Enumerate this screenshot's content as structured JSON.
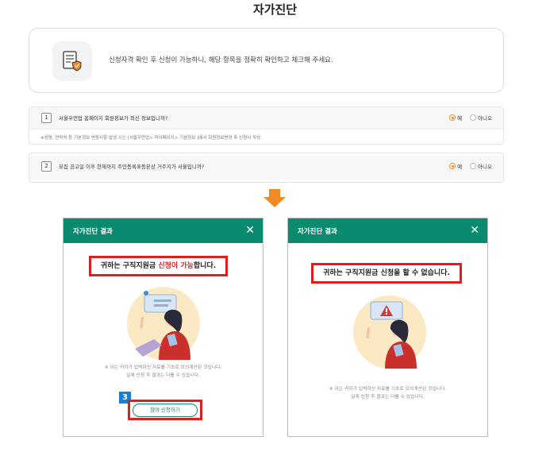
{
  "page": {
    "title": "자가진단"
  },
  "notice": {
    "text": "신청자격 확인 후 신청이 가능하니, 해당 항목을 정확히 확인하고 체크해 주세요."
  },
  "questions": [
    {
      "number": "1",
      "text": "서울우먼업 홈페이지 회원정보가 최신 정보입니까?",
      "note": "※성명, 연락처 등 기본정보 변동사항 발생 시는 [서울우먼업> 마이페이지> 기본정보 ]에서 회원정보변경 후 신청서 작성.",
      "options": [
        "예",
        "아니오"
      ],
      "selected": "예"
    },
    {
      "number": "2",
      "text": "모집 공고일 이후 현재까지 주민등록표등본상 거주지가 서울입니까?",
      "options": [
        "예",
        "아니오"
      ],
      "selected": "예"
    }
  ],
  "modals": {
    "left": {
      "title": "자가진단 결과",
      "result_prefix": "귀하는 구직지원금 ",
      "result_highlight": "신청이 가능",
      "result_suffix": "합니다.",
      "note_line1": "※ 이는 귀하가 입력하신 자료를 기초로 모의계산된 것입니다.",
      "note_line2": "실제 신청 후 결과는 다를 수 있습니다.",
      "step_badge": "3",
      "apply_label": "참여 신청하기"
    },
    "right": {
      "title": "자가진단 결과",
      "result": "귀하는 구직지원금 신청을 할 수 없습니다.",
      "note_line1": "※ 이는 귀하가 입력하신 자료를 기초로 모의계산된 것입니다.",
      "note_line2": "실제 신청 후 결과는 다를 수 있습니다."
    }
  },
  "colors": {
    "brand_green": "#0a8a6e",
    "alert_red": "#e21d1d",
    "accent_orange": "#f08a24",
    "step_blue": "#1a7ed6"
  }
}
